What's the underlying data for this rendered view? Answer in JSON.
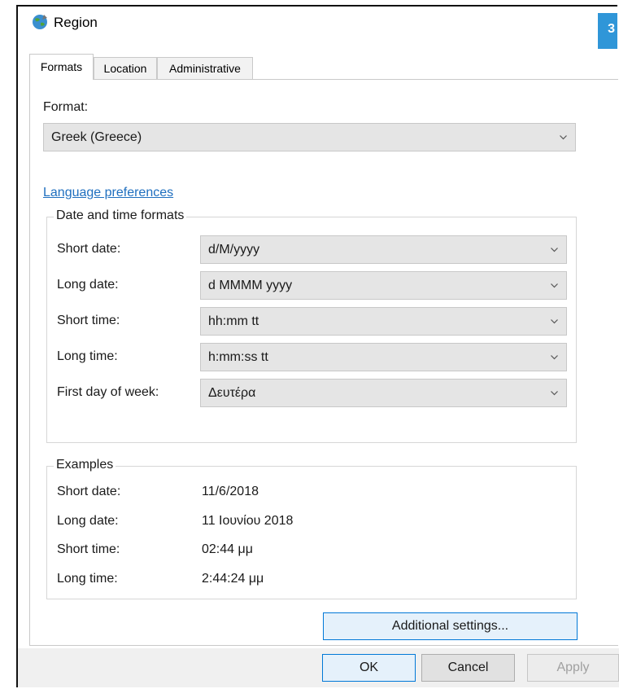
{
  "window": {
    "title": "Region",
    "badge": "3"
  },
  "tabs": [
    {
      "label": "Formats",
      "active": true
    },
    {
      "label": "Location",
      "active": false
    },
    {
      "label": "Administrative",
      "active": false
    }
  ],
  "format": {
    "label": "Format:",
    "value": "Greek (Greece)"
  },
  "language_link": "Language preferences",
  "date_time": {
    "title": "Date and time formats",
    "rows": [
      {
        "label": "Short date:",
        "value": "d/M/yyyy"
      },
      {
        "label": "Long date:",
        "value": "d MMMM yyyy"
      },
      {
        "label": "Short time:",
        "value": "hh:mm tt"
      },
      {
        "label": "Long time:",
        "value": "h:mm:ss tt"
      },
      {
        "label": "First day of week:",
        "value": "Δευτέρα"
      }
    ]
  },
  "examples": {
    "title": "Examples",
    "rows": [
      {
        "label": "Short date:",
        "value": "11/6/2018"
      },
      {
        "label": "Long date:",
        "value": "11 Ιουνίου 2018"
      },
      {
        "label": "Short time:",
        "value": "02:44 μμ"
      },
      {
        "label": "Long time:",
        "value": "2:44:24 μμ"
      }
    ]
  },
  "buttons": {
    "additional": "Additional settings...",
    "ok": "OK",
    "cancel": "Cancel",
    "apply": "Apply"
  },
  "colors": {
    "link": "#1f6fbf",
    "accent": "#0078d7",
    "badge": "#2f96d8"
  },
  "icons": {
    "title": "globe-icon",
    "dropdown": "chevron-down-icon"
  }
}
